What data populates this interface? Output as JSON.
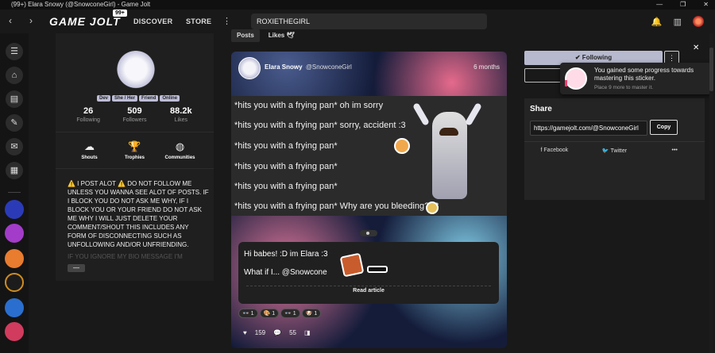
{
  "window": {
    "title": "(99+) Elara Snowy (@SnowconeGirl) - Game Jolt",
    "controls": [
      "—",
      "❐",
      "✕"
    ]
  },
  "nav": {
    "back": "‹",
    "forward": "›",
    "logo": "GAME JOLT",
    "badge": "99+",
    "discover": "DISCOVER",
    "store": "STORE",
    "more": "⋮",
    "search_value": "ROXIETHEGIRL"
  },
  "profile": {
    "tags": [
      "Dev",
      "She / Her",
      "Friend",
      "Online"
    ],
    "stats": [
      {
        "num": "26",
        "label": "Following"
      },
      {
        "num": "509",
        "label": "Followers"
      },
      {
        "num": "88.2k",
        "label": "Likes"
      }
    ],
    "actions": [
      {
        "icon": "☁",
        "label": "Shouts"
      },
      {
        "icon": "🏆",
        "label": "Trophies"
      },
      {
        "icon": "◍",
        "label": "Communities"
      }
    ],
    "bio": "⚠️ I POST ALOT ⚠️ DO NOT FOLLOW ME UNLESS YOU WANNA SEE ALOT OF POSTS. IF I BLOCK YOU DO NOT ASK ME WHY, IF I BLOCK YOU OR YOUR FRIEND DO NOT ASK ME WHY I WILL JUST DELETE YOUR COMMENT/SHOUT THIS INCLUDES ANY FORM OF DISCONNECTING SUCH AS UNFOLLOWING AND/OR UNFRIENDING.",
    "bio_fade": "IF YOU IGNORE MY BIO MESSAGE I'M",
    "more_button": "—"
  },
  "tabs": [
    {
      "label": "Posts"
    },
    {
      "label": "Likes 🕊"
    }
  ],
  "post": {
    "author": "Elara Snowy",
    "handle": "@SnowconeGirl",
    "time": "6 months",
    "lines": [
      "*hits you with a frying pan* oh im sorry",
      "*hits you with a frying pan* sorry, accident :3",
      "*hits you with a frying pan*",
      "*hits you with a frying pan*",
      "*hits you with a frying pan*",
      "*hits you with a frying pan* Why are you bleeding? :3"
    ],
    "sub_line1": "Hi babes! :D im Elara :3",
    "sub_line2": "What if I... @Snowcone",
    "read_article": "Read article",
    "reactions": [
      "👓 1",
      "🎨 1",
      "👓 1",
      "🐶 1"
    ],
    "likes": "159",
    "comments": "55"
  },
  "side": {
    "following": "✔ Following",
    "menu": "⋮",
    "share_title": "Share",
    "share_url": "https://gamejolt.com/@SnowconeGirl",
    "copy": "Copy",
    "facebook": "f Facebook",
    "twitter": "🐦 Twitter",
    "more": "•••"
  },
  "toast": {
    "message": "You gained some progress towards mastering this sticker.",
    "sub": "Place 9 more to master it.",
    "close": "✕"
  }
}
